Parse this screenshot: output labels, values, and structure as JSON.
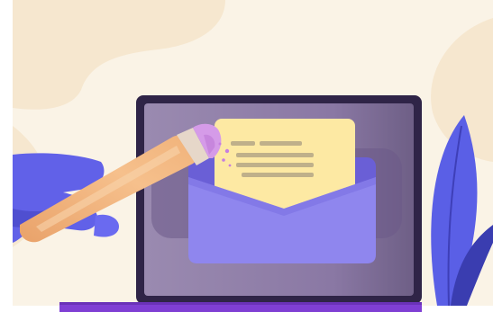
{
  "illustration": {
    "subject": "laptop-with-email-envelope",
    "icons": [
      "pencil-icon",
      "hand-icon",
      "envelope-icon",
      "letter-icon",
      "leaf-icon",
      "laptop-icon"
    ],
    "colors": {
      "background": "#faf3e6",
      "cream_blob": "#f6e7cf",
      "laptop_frame": "#2f2447",
      "screen": "#8d7ba6",
      "envelope_back": "#6a5fd6",
      "envelope_front": "#8f86ee",
      "letter": "#fde9a3",
      "letter_lines": "#bfb08a",
      "hand": "#6161e8",
      "pencil_body": "#f3b57c",
      "pencil_eraser": "#d59be8",
      "leaf": "#5a5fe6",
      "laptop_base": "#7f3fd4"
    }
  }
}
